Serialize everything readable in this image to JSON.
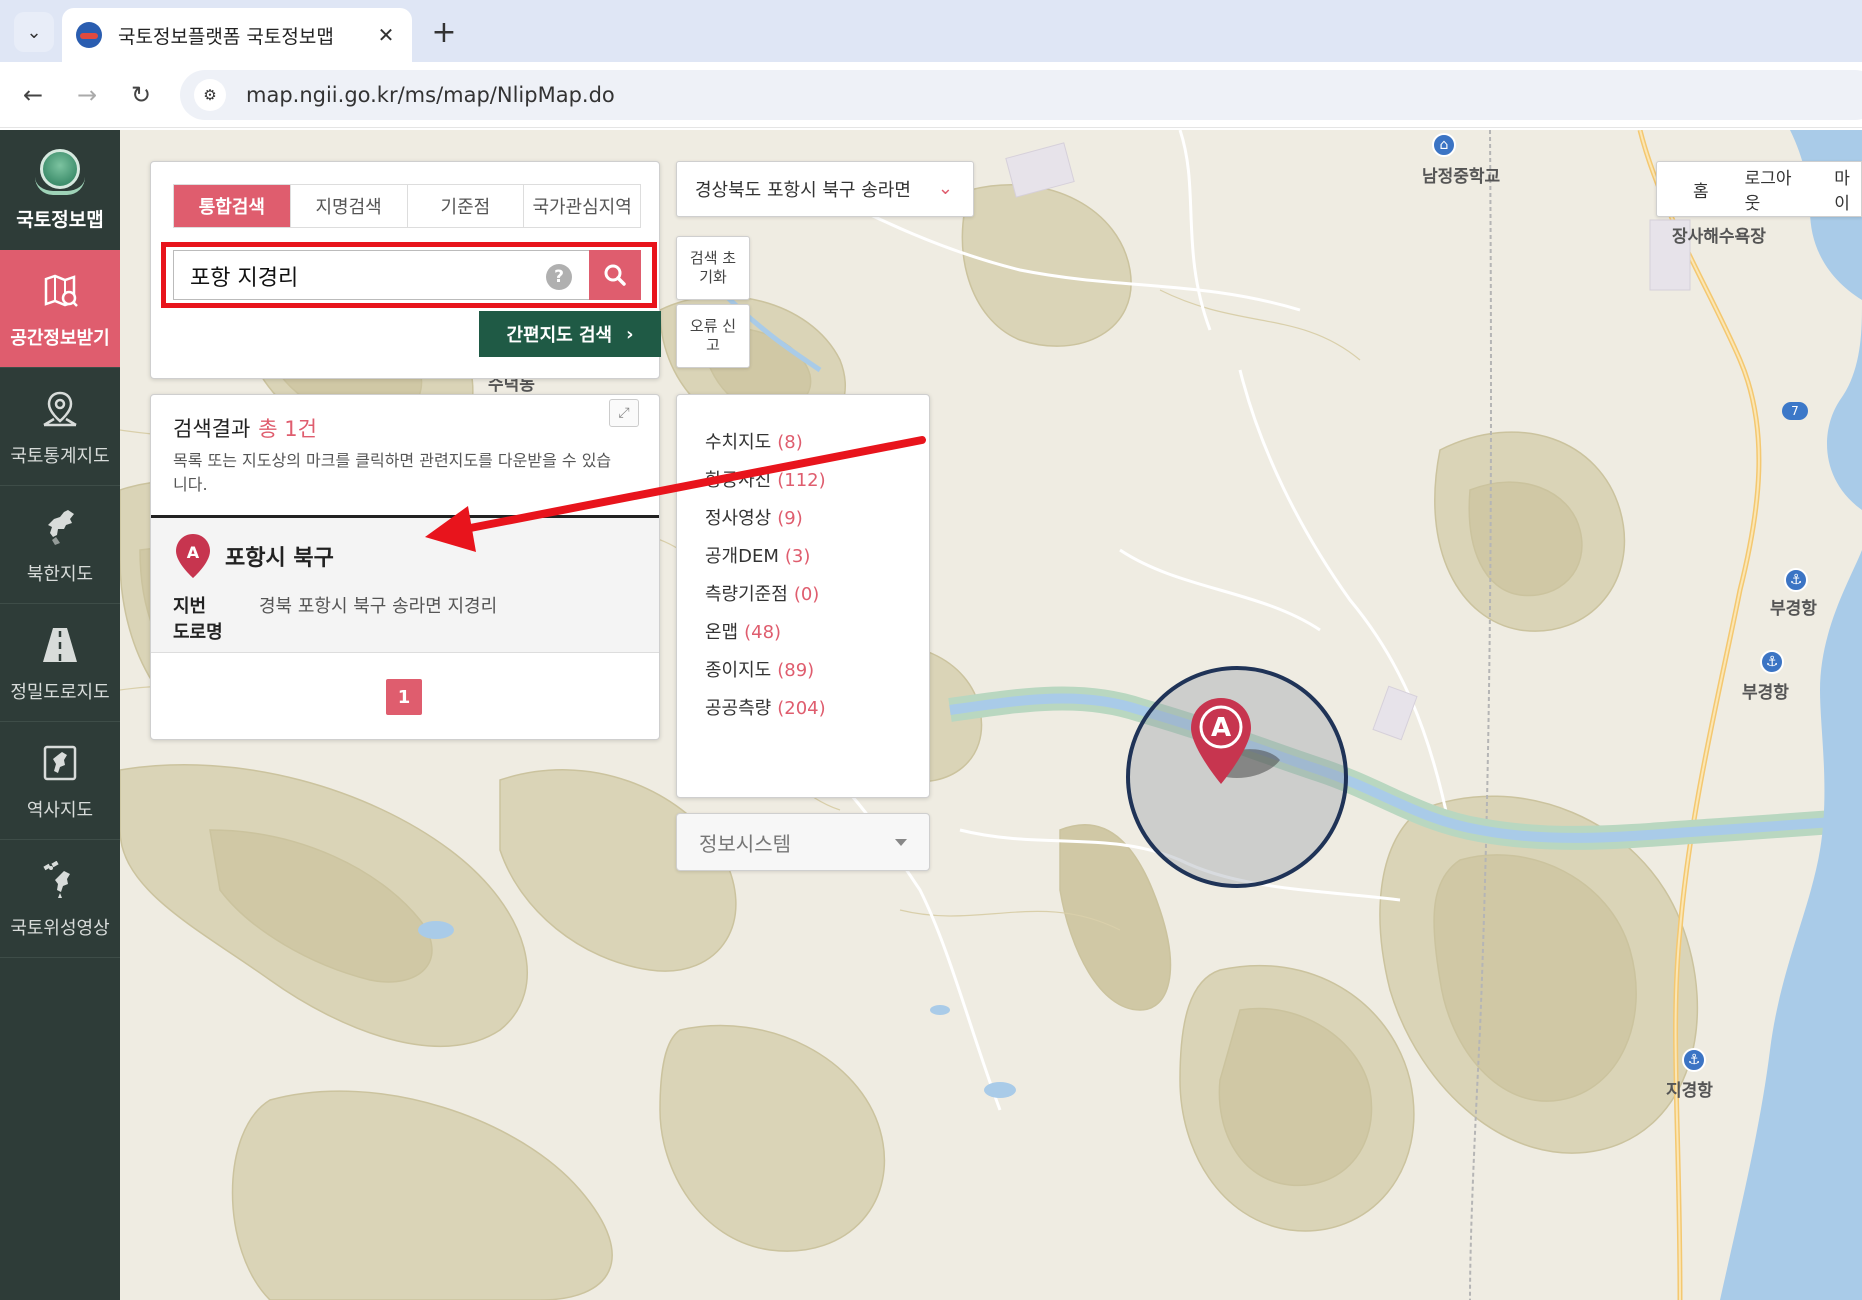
{
  "browser": {
    "tab_title": "국토정보플랫폼 국토정보맵",
    "url": "map.ngii.go.kr/ms/map/NlipMap.do",
    "close_glyph": "✕",
    "newtab_glyph": "+"
  },
  "sidebar": {
    "brand": "국토정보맵",
    "items": [
      {
        "label": "공간정보받기",
        "icon": "map-download-icon"
      },
      {
        "label": "국토통계지도",
        "icon": "stats-map-icon"
      },
      {
        "label": "북한지도",
        "icon": "north-korea-icon"
      },
      {
        "label": "정밀도로지도",
        "icon": "road-icon"
      },
      {
        "label": "역사지도",
        "icon": "history-map-icon"
      },
      {
        "label": "국토위성영상",
        "icon": "satellite-icon"
      }
    ]
  },
  "search": {
    "tabs": [
      "통합검색",
      "지명검색",
      "기준점",
      "국가관심지역"
    ],
    "query": "포항 지경리",
    "help": "?",
    "quick_search_label": "간편지도 검색"
  },
  "region_select": "경상북도 포항시 북구 송라면",
  "side_buttons": {
    "reset": "검색 초기화",
    "report": "오류 신고"
  },
  "top_links": [
    "홈",
    "로그아웃",
    "마이"
  ],
  "results": {
    "title": "검색결과",
    "count": "총 1건",
    "desc": "목록 또는 지도상의 마크를 클릭하면 관련지도를 다운받을 수 있습니다.",
    "item": {
      "marker": "A",
      "name": "포항시 북구",
      "key_lot": "지번",
      "key_road": "도로명",
      "address": "경북 포항시 북구 송라면 지경리"
    },
    "page": "1"
  },
  "categories": [
    {
      "label": "수치지도",
      "count": "(8)"
    },
    {
      "label": "항공사진",
      "count": "(112)"
    },
    {
      "label": "정사영상",
      "count": "(9)"
    },
    {
      "label": "공개DEM",
      "count": "(3)"
    },
    {
      "label": "측량기준점",
      "count": "(0)"
    },
    {
      "label": "온맵",
      "count": "(48)"
    },
    {
      "label": "종이지도",
      "count": "(89)"
    },
    {
      "label": "공공측량",
      "count": "(204)"
    }
  ],
  "info_system": "정보시스템",
  "map_labels": {
    "school": "남정중학교",
    "beach": "장사해수욕장",
    "port1": "부경항",
    "port2": "부경항",
    "port3": "지경항",
    "area": "수덕동",
    "route": "7",
    "map_marker": "A"
  },
  "colors": {
    "accent": "#df5d6e",
    "sidebar_bg": "#2e3c38",
    "quick_search": "#1f5a45",
    "highlight": "#e8141c",
    "sea": "#a9cbe8"
  }
}
